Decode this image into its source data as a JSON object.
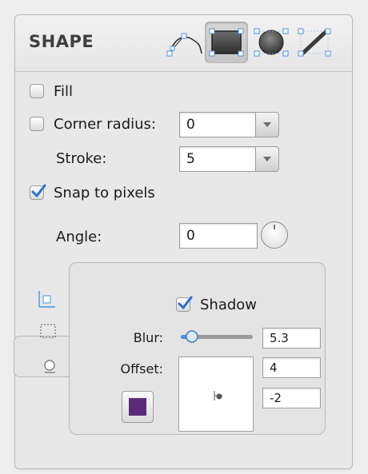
{
  "header": {
    "title": "SHAPE"
  },
  "tools": [
    {
      "name": "path-tool-icon",
      "active": false
    },
    {
      "name": "rectangle-tool-icon",
      "active": true
    },
    {
      "name": "ellipse-tool-icon",
      "active": false
    },
    {
      "name": "line-tool-icon",
      "active": false
    }
  ],
  "fill": {
    "label": "Fill",
    "checked": false
  },
  "corner_radius": {
    "label": "Corner radius:",
    "value": "0",
    "checked": false
  },
  "stroke": {
    "label": "Stroke:",
    "value": "5"
  },
  "snap": {
    "label": "Snap to pixels",
    "checked": true
  },
  "angle": {
    "label": "Angle:",
    "value": "0"
  },
  "shadow": {
    "label": "Shadow",
    "checked": true,
    "blur_label": "Blur:",
    "blur_value": "5.3",
    "blur_slider_fraction": 0.12,
    "offset_label": "Offset:",
    "offset_x": "4",
    "offset_y": "-2",
    "color": "#5b2b7a"
  },
  "side_tabs": [
    "align-icon",
    "selection-icon",
    "shadow-icon"
  ],
  "colors": {
    "check": "#2a6fd6",
    "handle": "#4a90e2"
  }
}
